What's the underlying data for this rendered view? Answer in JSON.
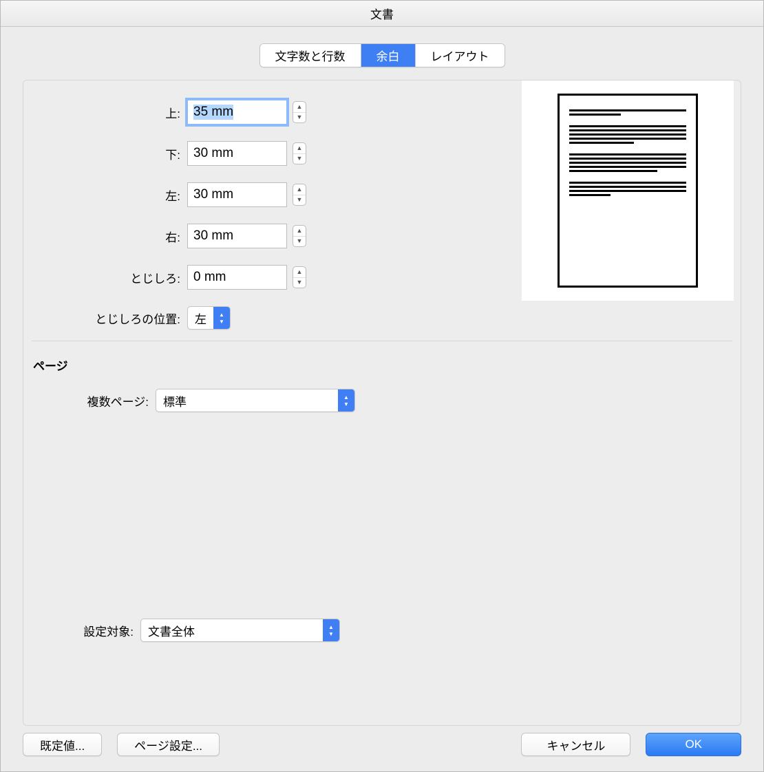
{
  "title": "文書",
  "tabs": {
    "chars": "文字数と行数",
    "margins": "余白",
    "layout": "レイアウト"
  },
  "margins": {
    "top_label": "上:",
    "top_value": "35 mm",
    "bottom_label": "下:",
    "bottom_value": "30 mm",
    "left_label": "左:",
    "left_value": "30 mm",
    "right_label": "右:",
    "right_value": "30 mm",
    "gutter_label": "とじしろ:",
    "gutter_value": "0 mm",
    "gutter_pos_label": "とじしろの位置:",
    "gutter_pos_value": "左"
  },
  "pages": {
    "heading": "ページ",
    "multi_label": "複数ページ:",
    "multi_value": "標準"
  },
  "apply": {
    "label": "設定対象:",
    "value": "文書全体"
  },
  "buttons": {
    "defaults": "既定値...",
    "page_setup": "ページ設定...",
    "cancel": "キャンセル",
    "ok": "OK"
  }
}
